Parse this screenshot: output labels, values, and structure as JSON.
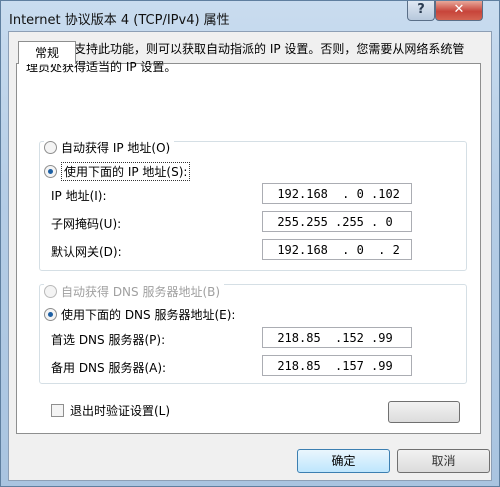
{
  "window": {
    "title": "Internet 协议版本 4 (TCP/IPv4) 属性",
    "help_label": "?",
    "close_label": "✕"
  },
  "tab": {
    "label": "常规"
  },
  "description": "如果网络支持此功能，则可以获取自动指派的 IP 设置。否则，您需要从网络系统管理员处获得适当的 IP 设置。",
  "ip_section": {
    "auto_label": "自动获得 IP 地址(O)",
    "manual_label": "使用下面的 IP 地址(S):",
    "selected": "manual",
    "fields": [
      {
        "label": "IP 地址(I):",
        "octets": [
          "192",
          "168",
          "0",
          "102"
        ]
      },
      {
        "label": "子网掩码(U):",
        "octets": [
          "255",
          "255",
          "255",
          "0"
        ]
      },
      {
        "label": "默认网关(D):",
        "octets": [
          "192",
          "168",
          "0",
          "2"
        ]
      }
    ]
  },
  "dns_section": {
    "auto_label": "自动获得 DNS 服务器地址(B)",
    "manual_label": "使用下面的 DNS 服务器地址(E):",
    "selected": "manual",
    "fields": [
      {
        "label": "首选 DNS 服务器(P):",
        "octets": [
          "218",
          "85",
          "152",
          "99"
        ]
      },
      {
        "label": "备用 DNS 服务器(A):",
        "octets": [
          "218",
          "85",
          "157",
          "99"
        ]
      }
    ]
  },
  "validate_label": "退出时验证设置(L)",
  "validate_checked": false,
  "buttons": {
    "ok_label": "确定",
    "cancel_label": "取消"
  }
}
